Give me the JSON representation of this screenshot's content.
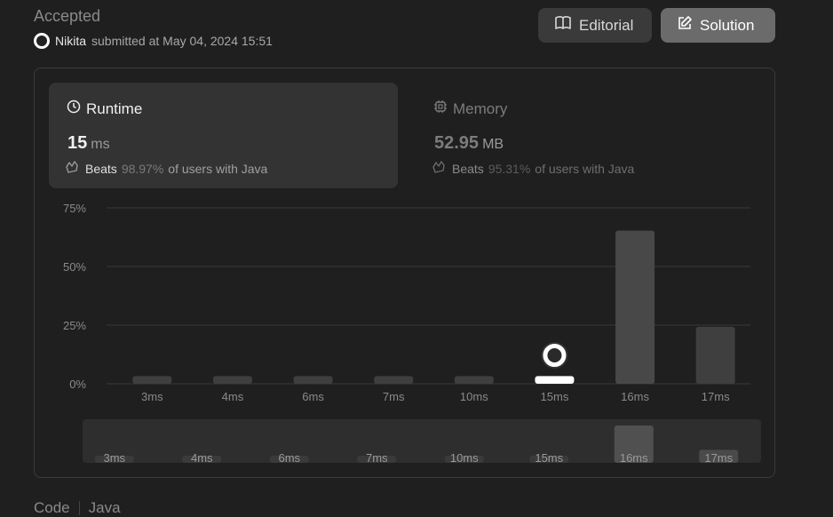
{
  "submission": {
    "status": "Accepted",
    "user": "Nikita",
    "submitted_text": "submitted at May 04, 2024 15:51"
  },
  "buttons": {
    "editorial": "Editorial",
    "solution": "Solution"
  },
  "runtime": {
    "title": "Runtime",
    "value": "15",
    "unit": "ms",
    "beats_label": "Beats",
    "beats_pct": "98.97%",
    "beats_suffix": "of users with Java"
  },
  "memory": {
    "title": "Memory",
    "value": "52.95",
    "unit": "MB",
    "beats_label": "Beats",
    "beats_pct": "95.31%",
    "beats_suffix": "of users with Java"
  },
  "code": {
    "label": "Code",
    "language": "Java"
  },
  "colors": {
    "bar": "#3f3f3f",
    "bar_highlight": "#ffffff",
    "bar_tall": "#484848",
    "grid": "#3a3a3a"
  },
  "icons": {
    "editorial": "book-icon",
    "solution": "edit-icon",
    "runtime": "clock-icon",
    "memory": "chip-icon",
    "beats": "clap-icon"
  },
  "chart_data": {
    "type": "bar",
    "categories": [
      "3ms",
      "4ms",
      "6ms",
      "7ms",
      "10ms",
      "15ms",
      "16ms",
      "17ms"
    ],
    "values": [
      1,
      1,
      1,
      1,
      1,
      1,
      63,
      22
    ],
    "yticks": [
      "0%",
      "25%",
      "50%",
      "75%"
    ],
    "ylim": [
      0,
      75
    ],
    "highlight": "15ms",
    "grid": true
  }
}
